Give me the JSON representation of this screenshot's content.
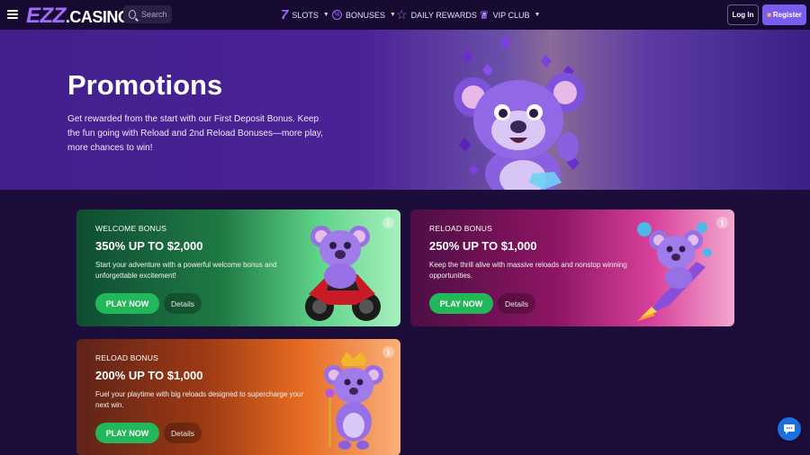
{
  "header": {
    "logo_ezz": "EZZ",
    "logo_casino": ".CASINO",
    "search_placeholder": "Search",
    "nav": [
      {
        "label": "SLOTS",
        "icon": "seven-icon"
      },
      {
        "label": "BONUSES",
        "icon": "percent-badge-icon"
      },
      {
        "label": "DAILY REWARDS",
        "icon": "star-icon"
      },
      {
        "label": "VIP CLUB",
        "icon": "crown-icon"
      }
    ],
    "login_label": "Log In",
    "register_label": "Register"
  },
  "hero": {
    "title": "Promotions",
    "description": "Get rewarded from the start with our First Deposit Bonus. Keep the fun going with Reload and 2nd Reload Bonuses—more play, more chances to win!"
  },
  "cards": [
    {
      "eyebrow": "WELCOME BONUS",
      "headline": "350% UP TO $2,000",
      "text": "Start your adventure with a powerful welcome bonus and unforgettable excitement!",
      "play_label": "PLAY NOW",
      "details_label": "Details"
    },
    {
      "eyebrow": "RELOAD BONUS",
      "headline": "250% UP TO $1,000",
      "text": "Keep the thrill alive with massive reloads and nonstop winning opportunities.",
      "play_label": "PLAY NOW",
      "details_label": "Details"
    },
    {
      "eyebrow": "RELOAD BONUS",
      "headline": "200% UP TO $1,000",
      "text": "Fuel your playtime with big reloads designed to supercharge your next win.",
      "play_label": "PLAY NOW",
      "details_label": "Details"
    }
  ],
  "colors": {
    "accent": "#a56bff",
    "play_button": "#22b85a",
    "register_button": "#7b5cf0",
    "chat_button": "#1a6fdc"
  }
}
